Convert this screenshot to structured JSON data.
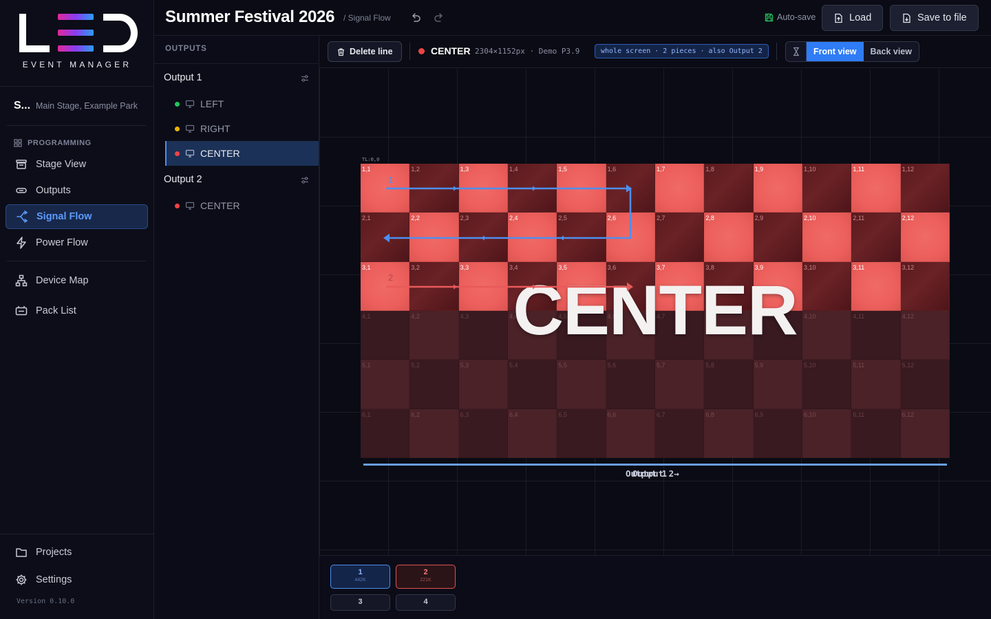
{
  "brand": {
    "logo_text": "LED",
    "subtitle": "EVENT MANAGER"
  },
  "project": {
    "name": "S...",
    "location": "Main Stage, Example Park"
  },
  "sidebar": {
    "section": "PROGRAMMING",
    "items": [
      {
        "label": "Stage View",
        "icon": "stage-icon"
      },
      {
        "label": "Outputs",
        "icon": "outputs-icon"
      },
      {
        "label": "Signal Flow",
        "icon": "signal-flow-icon",
        "active": true
      },
      {
        "label": "Power Flow",
        "icon": "bolt-icon"
      },
      {
        "label": "Device Map",
        "icon": "device-map-icon"
      },
      {
        "label": "Pack List",
        "icon": "pack-list-icon"
      }
    ],
    "bottom": [
      {
        "label": "Projects",
        "icon": "folder-icon"
      },
      {
        "label": "Settings",
        "icon": "gear-icon"
      }
    ],
    "version": "Version 0.10.0"
  },
  "header": {
    "title": "Summer Festival 2026",
    "breadcrumb": "/ Signal Flow",
    "autosave": "Auto-save",
    "load": "Load",
    "save": "Save to file"
  },
  "outputs_panel": {
    "title": "OUTPUTS",
    "groups": [
      {
        "name": "Output 1",
        "screens": [
          {
            "name": "LEFT",
            "status": "#22c55e"
          },
          {
            "name": "RIGHT",
            "status": "#eab308"
          },
          {
            "name": "CENTER",
            "status": "#ef4444",
            "active": true
          }
        ]
      },
      {
        "name": "Output 2",
        "screens": [
          {
            "name": "CENTER",
            "status": "#ef4444"
          }
        ]
      }
    ]
  },
  "toolbar": {
    "delete_line": "Delete line",
    "screen_name": "CENTER",
    "screen_meta": "2304×1152px · Demo P3.9",
    "badge": "whole screen · 2 pieces · also Output 2",
    "front_view": "Front view",
    "back_view": "Back view"
  },
  "canvas": {
    "tl_label": "TL:0,0",
    "screen_label": "CENTER",
    "rows": 6,
    "cols": 12,
    "lit_rows": 3,
    "line_labels": [
      "1",
      "2"
    ],
    "output_label_a": "Output 1",
    "output_label_b": "Output 2→",
    "accent_blue": "#4d8ff0",
    "accent_red": "#e85a5a"
  },
  "ports": [
    {
      "number": "1",
      "load": "442K",
      "color": "#4d8ff0"
    },
    {
      "number": "2",
      "load": "221K",
      "color": "#e05252"
    },
    {
      "number": "3",
      "load": "",
      "color": ""
    },
    {
      "number": "4",
      "load": "",
      "color": ""
    }
  ]
}
